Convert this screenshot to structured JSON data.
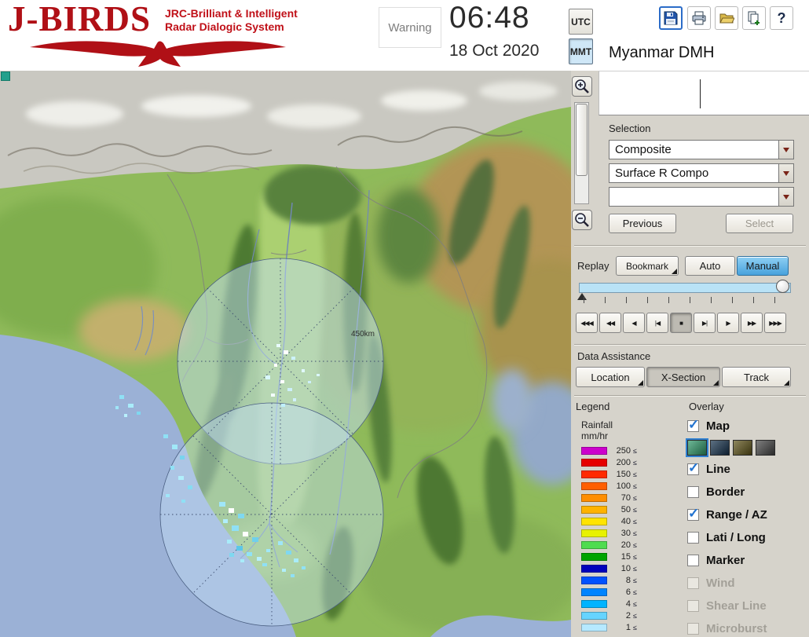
{
  "header": {
    "logo_title": "J-BIRDS",
    "logo_sub1": "JRC-Brilliant & Intelligent",
    "logo_sub2": "Radar  Dialogic  System",
    "warning": "Warning",
    "time": "06:48",
    "date": "18 Oct 2020",
    "tz": {
      "utc": "UTC",
      "mmt": "MMT"
    },
    "help_glyph": "?",
    "station": "Myanmar DMH",
    "accent_red": "#b01016",
    "toolbar_icons": [
      "save-icon",
      "print-icon",
      "open-folder-icon",
      "export-icon",
      "help-icon"
    ]
  },
  "map": {
    "range_label": "450km"
  },
  "selection": {
    "label": "Selection",
    "dropdowns": [
      {
        "value": "Composite"
      },
      {
        "value": "Surface R Compo"
      },
      {
        "value": ""
      }
    ],
    "previous_label": "Previous",
    "select_label": "Select"
  },
  "replay": {
    "label": "Replay",
    "bookmark_label": "Bookmark",
    "auto_label": "Auto",
    "manual_label": "Manual",
    "selected_mode": "Manual",
    "media": [
      "◀◀◀",
      "◀◀",
      "◀",
      "|◀",
      "■",
      "▶|",
      "▶",
      "▶▶",
      "▶▶▶"
    ]
  },
  "data_assistance": {
    "label": "Data Assistance",
    "location_label": "Location",
    "xsection_label": "X-Section",
    "track_label": "Track"
  },
  "legend": {
    "label": "Legend",
    "unit_line1": "Rainfall",
    "unit_line2": "mm/hr",
    "lte": "≤",
    "rows": [
      {
        "value": "250",
        "color": "#cc00cc"
      },
      {
        "value": "200",
        "color": "#e60000"
      },
      {
        "value": "150",
        "color": "#ff2a00"
      },
      {
        "value": "100",
        "color": "#ff5f00"
      },
      {
        "value": "70",
        "color": "#ff8e00"
      },
      {
        "value": "50",
        "color": "#ffb300"
      },
      {
        "value": "40",
        "color": "#ffe400"
      },
      {
        "value": "30",
        "color": "#e8f200"
      },
      {
        "value": "20",
        "color": "#4fdc4f"
      },
      {
        "value": "15",
        "color": "#00a400"
      },
      {
        "value": "10",
        "color": "#0000bc"
      },
      {
        "value": "8",
        "color": "#0051ff"
      },
      {
        "value": "6",
        "color": "#0084ff"
      },
      {
        "value": "4",
        "color": "#00b4ff"
      },
      {
        "value": "2",
        "color": "#66d4ff"
      },
      {
        "value": "1",
        "color": "#b6e9ff"
      }
    ]
  },
  "overlay": {
    "label": "Overlay",
    "map_styles": [
      {
        "color": "#2f9a6a",
        "selected": true
      },
      {
        "color": "#16334e",
        "selected": false
      },
      {
        "color": "#5f5418",
        "selected": false
      },
      {
        "color": "#474747",
        "selected": false
      }
    ],
    "items": [
      {
        "label": "Map",
        "checked": true,
        "enabled": true
      },
      {
        "label": "Line",
        "checked": true,
        "enabled": true
      },
      {
        "label": "Border",
        "checked": false,
        "enabled": true
      },
      {
        "label": "Range / AZ",
        "checked": true,
        "enabled": true
      },
      {
        "label": "Lati / Long",
        "checked": false,
        "enabled": true
      },
      {
        "label": "Marker",
        "checked": false,
        "enabled": true
      },
      {
        "label": "Wind",
        "checked": false,
        "enabled": false
      },
      {
        "label": "Shear Line",
        "checked": false,
        "enabled": false
      },
      {
        "label": "Microburst",
        "checked": false,
        "enabled": false
      }
    ]
  }
}
